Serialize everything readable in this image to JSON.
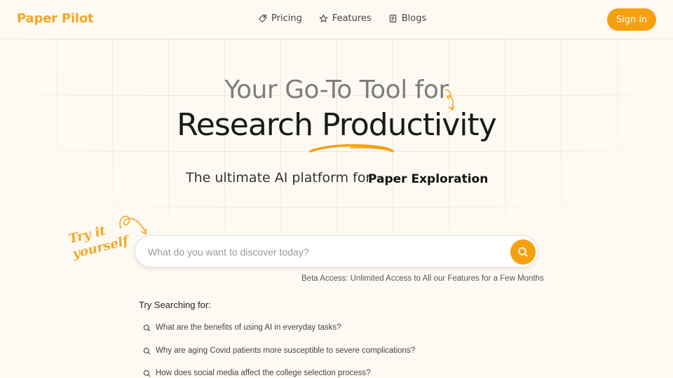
{
  "header": {
    "logo": "Paper Pilot",
    "nav": [
      {
        "label": "Pricing",
        "icon": "tag-icon"
      },
      {
        "label": "Features",
        "icon": "star-icon"
      },
      {
        "label": "Blogs",
        "icon": "document-icon"
      }
    ],
    "signin_label": "Sign in"
  },
  "hero": {
    "title_line1": "Your Go-To Tool for",
    "title_line2": "Research Productivity",
    "subtitle": "The ultimate AI platform for",
    "subtitle_highlight": "Paper Exploration"
  },
  "try_label_line1": "Try it",
  "try_label_line2": "yourself",
  "search": {
    "placeholder": "What do you want to discover today?",
    "button_icon": "search-icon"
  },
  "beta_note": "Beta Access: Unlimited Access to All our Features for a Few Months",
  "suggestions": {
    "title": "Try Searching for:",
    "items": [
      "What are the benefits of using AI in everyday tasks?",
      "Why are aging Covid patients more susceptible to severe complications?",
      "How does social media affect the college selection process?"
    ]
  },
  "colors": {
    "accent": "#f5a00f",
    "background": "#fdfaf3"
  }
}
